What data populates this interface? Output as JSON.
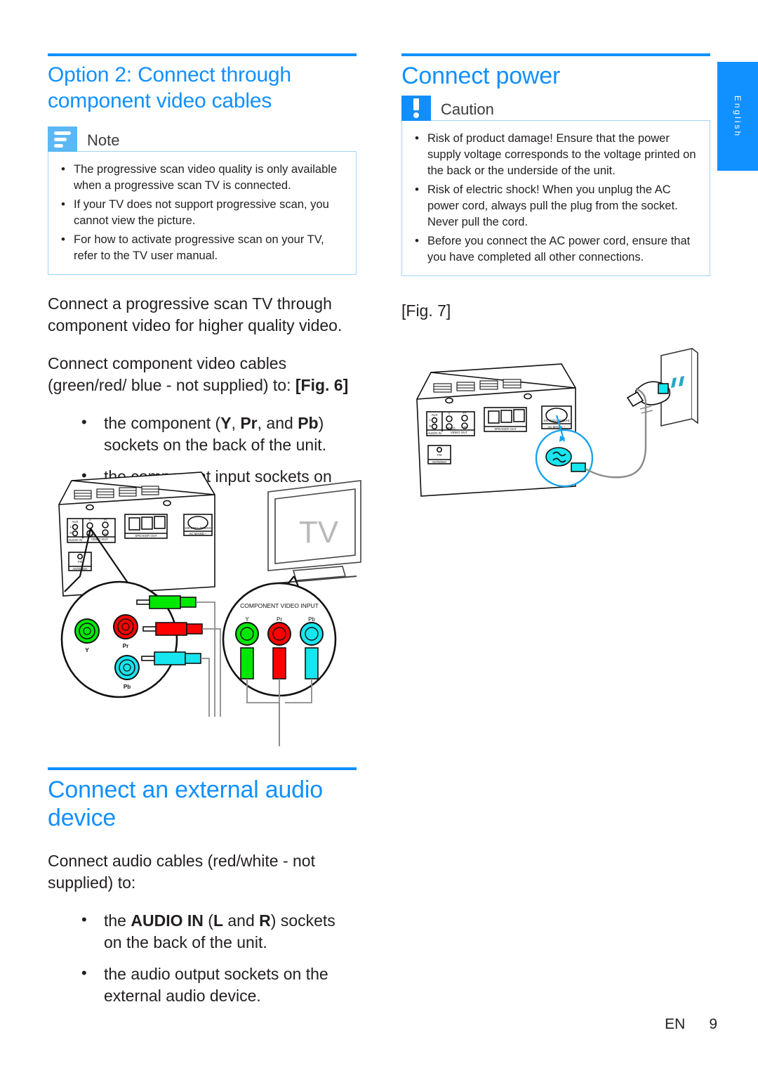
{
  "colors": {
    "accent_blue": "#1190ff",
    "note_badge_blue": "#5bb8f5",
    "caution_badge_blue": "#0f8fff",
    "callout_border": "#9fd4f7",
    "text": "#231f20",
    "socket_green": "#00e800",
    "socket_red": "#ff0000",
    "socket_cyan": "#17e5ef"
  },
  "left_column": {
    "heading": "Option 2: Connect through component video cables",
    "note": {
      "title": "Note",
      "icon": "note-lines-icon",
      "bullets": [
        "The progressive scan video quality is only available when a progressive scan TV is connected.",
        "If your TV does not support progressive scan, you cannot view the picture.",
        "For how to activate progressive scan on your TV, refer to the TV user manual."
      ]
    },
    "paragraph_1": "Connect a progressive scan TV through component video for higher quality video.",
    "paragraph_2_plain": "Connect component video cables (green/red/ blue - not supplied) to: ",
    "paragraph_2_figref": "[Fig. 6]",
    "bullets": [
      {
        "pre": "the component (",
        "b1": "Y",
        "mid1": ", ",
        "b2": "Pr",
        "mid2": ", and ",
        "b3": "Pb",
        "post": ") sockets on the back of the unit."
      },
      {
        "pre": "the component input sockets on the TV.",
        "b1": "",
        "mid1": "",
        "b2": "",
        "mid2": "",
        "b3": "",
        "post": ""
      }
    ],
    "audio_section": {
      "heading": "Connect an external audio device",
      "paragraph": "Connect audio cables (red/white - not supplied) to:",
      "bullets": [
        {
          "pre": "the ",
          "b1": "AUDIO IN",
          "mid1": " (",
          "b2": "L",
          "mid2": " and ",
          "b3": "R",
          "post": ") sockets on the back of the unit."
        },
        {
          "pre": "the audio output sockets on the external audio device.",
          "b1": "",
          "mid1": "",
          "b2": "",
          "mid2": "",
          "b3": "",
          "post": ""
        }
      ]
    }
  },
  "right_column": {
    "heading": "Connect power",
    "caution": {
      "title": "Caution",
      "icon": "exclamation-icon",
      "bullets": [
        "Risk of product damage! Ensure that the power supply voltage corresponds to the voltage printed on the back or the underside of the unit.",
        "Risk of electric shock! When you unplug the AC power cord, always pull the plug from the socket. Never pull the cord.",
        "Before you connect the AC power cord, ensure that you have completed all other connections."
      ]
    },
    "figure_label": "[Fig. 7]"
  },
  "figure6": {
    "label_tv": "TV",
    "unit_panel": {
      "aux": "AUX",
      "l": "L",
      "r": "R",
      "y": "Y",
      "pr": "Pr",
      "pb": "Pb",
      "video": "VIDEO",
      "audio_in": "AUDIO IN",
      "video_out": "VIDEO OUT",
      "speaker_out": "SPEAKER OUT",
      "ac_mains": "AC MAINS ~",
      "ac_rating": "100-240V~50/60Hz",
      "fm": "FM",
      "antenna": "ANTENNA"
    },
    "callout_unit": {
      "y": "Y",
      "pr": "Pr",
      "pb": "Pb"
    },
    "callout_tv": {
      "title": "COMPONENT VIDEO INPUT",
      "y": "Y",
      "pr": "Pr",
      "pb": "Pb"
    }
  },
  "figure7": {
    "unit_panel": {
      "aux": "AUX",
      "l": "L",
      "r": "R",
      "y": "Y",
      "pr": "Pr",
      "pb": "Pb",
      "video": "VIDEO",
      "audio_in": "AUDIO IN",
      "video_out": "VIDEO OUT",
      "speaker_out": "SPEAKER OUT",
      "ac_mains": "AC MAINS ~",
      "ac_rating": "100-240V~50/60Hz",
      "fm": "FM",
      "antenna": "ANTENNA"
    }
  },
  "side_tab": {
    "language": "English"
  },
  "footer": {
    "lang_code": "EN",
    "page_number": "9"
  }
}
